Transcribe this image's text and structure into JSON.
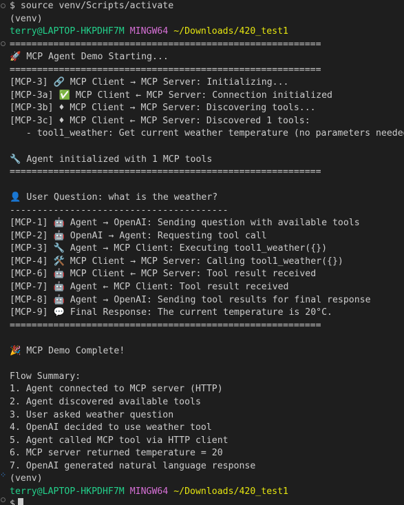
{
  "colors": {
    "background": "#1e1e1e",
    "text": "#cccccc",
    "prompt_user": "#23d18b",
    "prompt_shell": "#d670d6",
    "prompt_path": "#e5e510"
  },
  "prompt": {
    "user": "terry@LAPTOP-HKPDHF7M",
    "shell": "MINGW64",
    "path": "~/Downloads/420_test1"
  },
  "lines": [
    "$ source venv/Scripts/activate",
    "(venv)",
    "=========================================================",
    "🚀 MCP Agent Demo Starting...",
    "=========================================================",
    "[MCP-3] 🔗 MCP Client → MCP Server: Initializing...",
    "[MCP-3a] ✅ MCP Client ← MCP Server: Connection initialized",
    "[MCP-3b] ♦ MCP Client → MCP Server: Discovering tools...",
    "[MCP-3c] ♦ MCP Client ← MCP Server: Discovered 1 tools:",
    "   - tool1_weather: Get current weather temperature (no parameters needed",
    "",
    "🔧 Agent initialized with 1 MCP tools",
    "=========================================================",
    "",
    "👤 User Question: what is the weather?",
    "----------------------------------------",
    "[MCP-1] 🤖 Agent → OpenAI: Sending question with available tools",
    "[MCP-2] 🤖 OpenAI → Agent: Requesting tool call",
    "[MCP-3] 🔧 Agent → MCP Client: Executing tool1_weather({})",
    "[MCP-4] 🛠️ MCP Client → MCP Server: Calling tool1_weather({})",
    "[MCP-6] 🤖 MCP Client ← MCP Server: Tool result received",
    "[MCP-7] 🤖 Agent ← MCP Client: Tool result received",
    "[MCP-8] 🤖 Agent → OpenAI: Sending tool results for final response",
    "[MCP-9] 💬 Final Response: The current temperature is 20°C.",
    "=========================================================",
    "",
    "🎉 MCP Demo Complete!",
    "",
    "Flow Summary:",
    "1. Agent connected to MCP server (HTTP)",
    "2. Agent discovered available tools",
    "3. User asked weather question",
    "4. OpenAI decided to use weather tool",
    "5. Agent called MCP tool via HTTP client",
    "6. MCP server returned temperature = 20",
    "7. OpenAI generated natural language response",
    "(venv)"
  ],
  "final_prompt_symbol": "$"
}
